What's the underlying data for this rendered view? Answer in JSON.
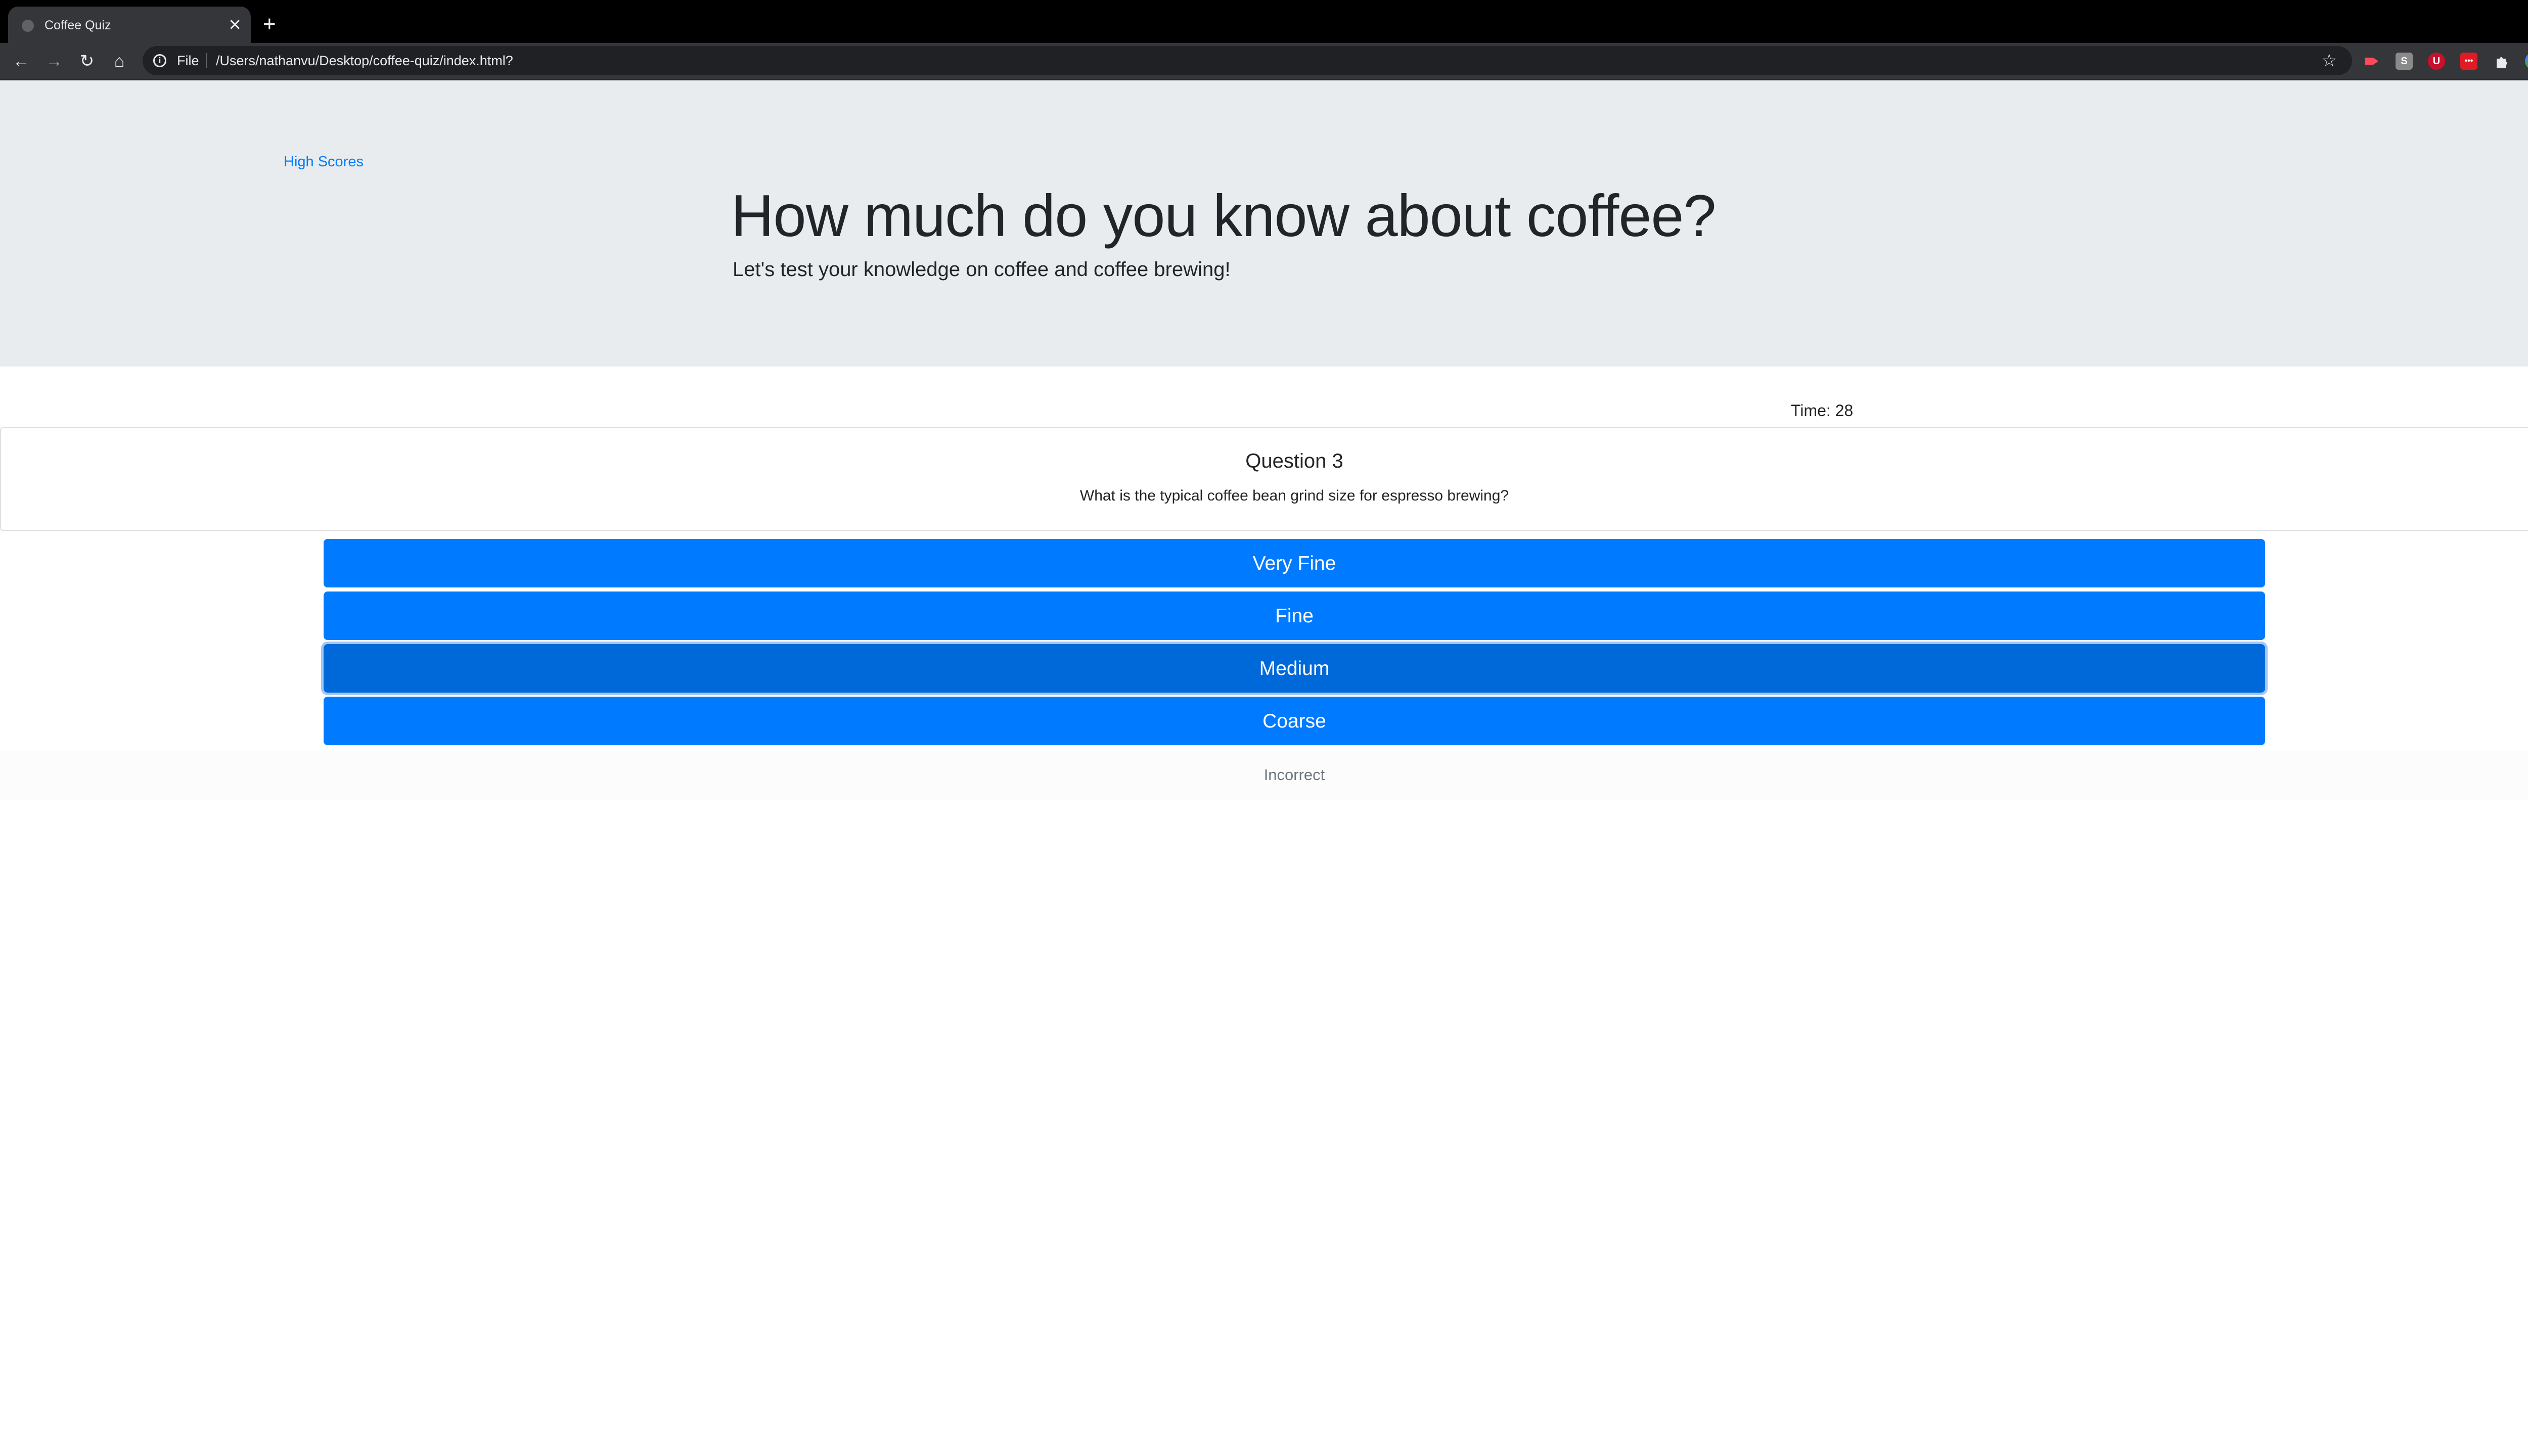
{
  "browser": {
    "tab_title": "Coffee Quiz",
    "tab_close": "✕",
    "new_tab": "+",
    "scheme": "File",
    "url": "/Users/nathanvu/Desktop/coffee-quiz/index.html?"
  },
  "header": {
    "high_scores_link": "High Scores",
    "title": "How much do you know about coffee?",
    "lead": "Let's test your knowledge on coffee and coffee brewing!"
  },
  "timer": {
    "text": "Time: 28"
  },
  "question": {
    "number": "Question 3",
    "text": "What is the typical coffee bean grind size for espresso brewing?"
  },
  "answers": [
    {
      "label": "Very Fine"
    },
    {
      "label": "Fine"
    },
    {
      "label": "Medium"
    },
    {
      "label": "Coarse"
    }
  ],
  "feedback": {
    "text": "Incorrect"
  },
  "colors": {
    "primary": "#007bff",
    "primary_active": "#0069d9",
    "jumbotron": "#e9ecef",
    "text": "#212529",
    "muted": "#6c757d"
  },
  "icons": [
    "back-arrow-icon",
    "forward-arrow-icon",
    "reload-icon",
    "home-icon",
    "info-icon",
    "star-icon",
    "puzzle-extensions-icon",
    "profile-avatar-icon",
    "menu-kebab-icon"
  ]
}
